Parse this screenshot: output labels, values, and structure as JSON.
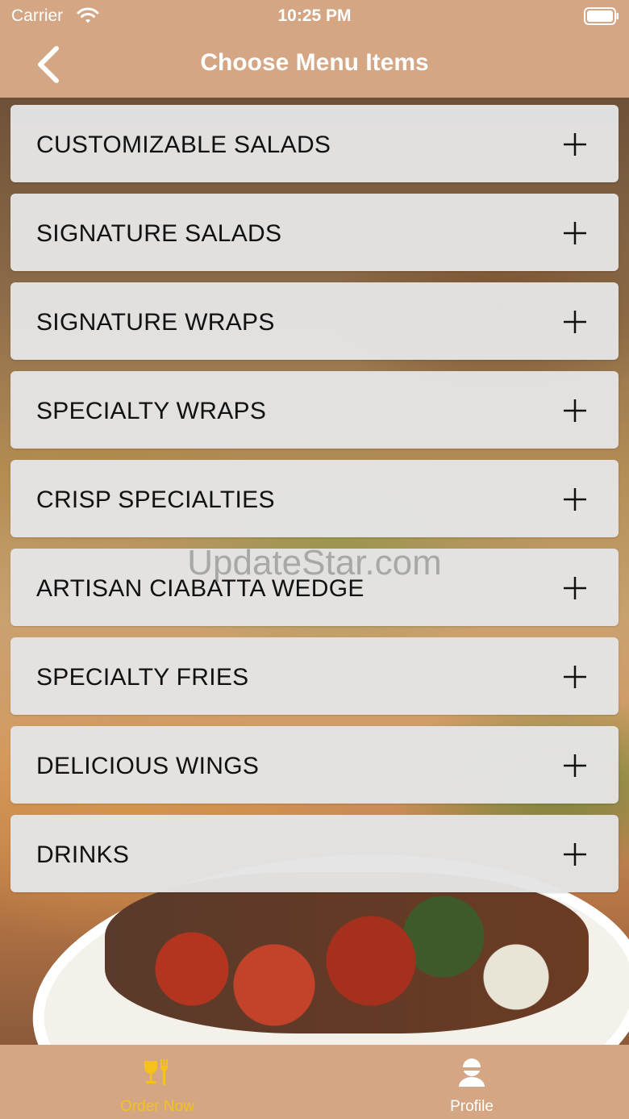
{
  "status_bar": {
    "carrier": "Carrier",
    "time": "10:25 PM"
  },
  "nav": {
    "title": "Choose Menu Items"
  },
  "menu": {
    "items": [
      {
        "label": "CUSTOMIZABLE SALADS"
      },
      {
        "label": "SIGNATURE SALADS"
      },
      {
        "label": "SIGNATURE WRAPS"
      },
      {
        "label": "SPECIALTY WRAPS"
      },
      {
        "label": "CRISP SPECIALTIES"
      },
      {
        "label": "ARTISAN CIABATTA WEDGE"
      },
      {
        "label": "SPECIALTY FRIES"
      },
      {
        "label": "DELICIOUS WINGS"
      },
      {
        "label": "DRINKS"
      }
    ]
  },
  "watermark": "UpdateStar.com",
  "tabs": [
    {
      "label": "Order Now",
      "icon": "order-icon",
      "active": true
    },
    {
      "label": "Profile",
      "icon": "profile-icon",
      "active": false
    }
  ],
  "colors": {
    "bar": "#d4a683",
    "active_tab": "#f5c21c",
    "item_bg": "#e4e4e4"
  }
}
